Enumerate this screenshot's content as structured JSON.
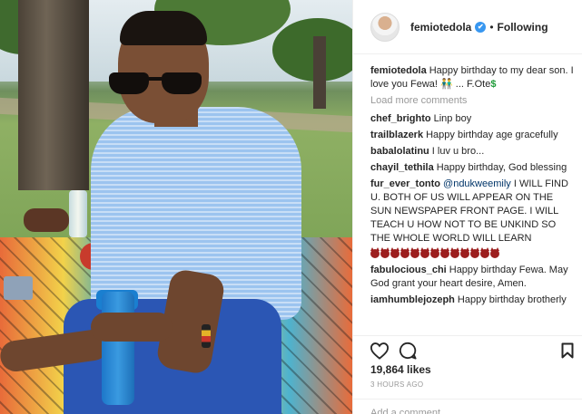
{
  "post": {
    "username": "femiotedola",
    "separator": "•",
    "follow_status": "Following",
    "verified_mark": "✔",
    "caption": {
      "user": "femiotedola",
      "text": "Happy birthday to my dear son. I love you Fewa! ",
      "emojis": "👬",
      "tail": " ... F.Ote",
      "money_emoji": "$"
    },
    "load_more": "Load more comments",
    "comments": [
      {
        "user": "chef_brighto",
        "text": "Linp boy"
      },
      {
        "user": "trailblazerk",
        "text": "Happy birthday age gracefully"
      },
      {
        "user": "babalolatinu",
        "text": "I luv u bro..."
      },
      {
        "user": "chayil_tethila",
        "text": "Happy birthday, God blessing"
      },
      {
        "user": "fur_ever_tonto",
        "mention": "@ndukweemily",
        "text": " I WILL FIND U. BOTH OF US WILL APPEAR ON THE SUN NEWSPAPER FRONT PAGE. I WILL TEACH U HOW NOT TO BE UNKIND SO THE WHOLE WORLD WILL LEARN",
        "emoji_icon": "devil-face-icon",
        "emoji_count": 13
      },
      {
        "user": "fabulocious_chi",
        "text": "Happy birthday Fewa. May God grant your heart desire, Amen."
      },
      {
        "user": "iamhumblejozeph",
        "text": "Happy birthday brotherly"
      }
    ],
    "likes": "19,864 likes",
    "time": "3 HOURS AGO",
    "add_comment_placeholder": "Add a comment..."
  },
  "colors": {
    "link_blue": "#003569",
    "verified_blue": "#3897f0",
    "muted_gray": "#999999",
    "money_green": "#1d9a38"
  },
  "icons": {
    "like": "heart-icon",
    "comment": "comment-bubble-icon",
    "save": "bookmark-icon",
    "verified": "verified-badge-icon"
  }
}
